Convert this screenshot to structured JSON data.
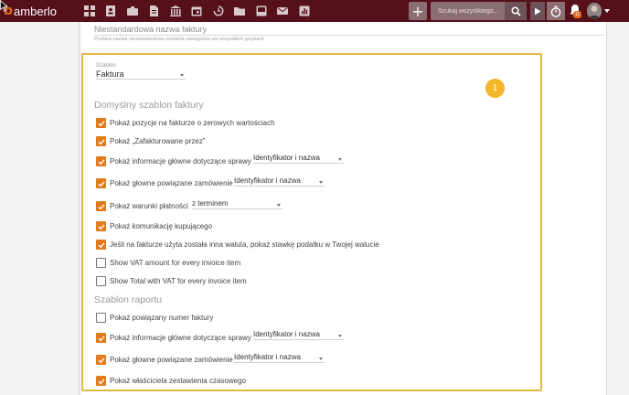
{
  "app": {
    "logo_mark": "b",
    "name": "amberlo"
  },
  "topbar": {
    "nav_icons": [
      "dashboard-icon",
      "contacts-icon",
      "briefcase-icon",
      "document-icon",
      "bank-icon",
      "calendar-icon",
      "history-icon",
      "folder-icon",
      "inbox-icon",
      "mail-icon",
      "reports-icon"
    ],
    "add_label": "+",
    "search_placeholder": "Szukaj wszystkiego...",
    "notification_count": "11"
  },
  "custom_name": {
    "label": "Niestandardowa nazwa faktury",
    "help": "Podana nazwa niestandardowa zostanie zastąpiona we wszystkich językach"
  },
  "marker": "1",
  "template": {
    "label": "Szablon",
    "value": "Faktura"
  },
  "invoice_section": {
    "title": "Domyślny szablon faktury",
    "items": [
      {
        "label": "Pokaż pozycje na fakturze o zerowych wartościach",
        "checked": true
      },
      {
        "label": "Pokaż „Zafakturowane przez”",
        "checked": true
      },
      {
        "label": "Pokaż informacje główne dotyczące sprawy",
        "checked": true,
        "select": "Identyfikator i nazwa"
      },
      {
        "label": "Pokaż głowne powiązane zamówienie",
        "checked": true,
        "select": "Identyfikator i nazwa"
      },
      {
        "label": "Pokaż warunki płatności",
        "checked": true,
        "select": "z terminem"
      },
      {
        "label": "Pokaż komunikację kupującego",
        "checked": true
      },
      {
        "label": "Jeśli na fakturze użyta została inna waluta, pokaż stawkę podatku w Twojej walucie",
        "checked": true
      },
      {
        "label": "Show VAT amount for every invoice item",
        "checked": false
      },
      {
        "label": "Show Total with VAT for every invoice item",
        "checked": false
      }
    ]
  },
  "report_section": {
    "title": "Szablon raportu",
    "items": [
      {
        "label": "Pokaż powiązany numer faktury",
        "checked": false
      },
      {
        "label": "Pokaż informacje główne dotyczące sprawy",
        "checked": true,
        "select": "Identyfikator i nazwa"
      },
      {
        "label": "Pokaż głowne powiązane zamówienie",
        "checked": true,
        "select": "Identyfikator i nazwa"
      },
      {
        "label": "Pokaż właściciela zestawienia czasowego",
        "checked": true
      }
    ]
  },
  "colors": {
    "topbar": "#55101a",
    "accent": "#e07c1e",
    "highlight_border": "#e2bb45",
    "marker": "#f3b626"
  }
}
